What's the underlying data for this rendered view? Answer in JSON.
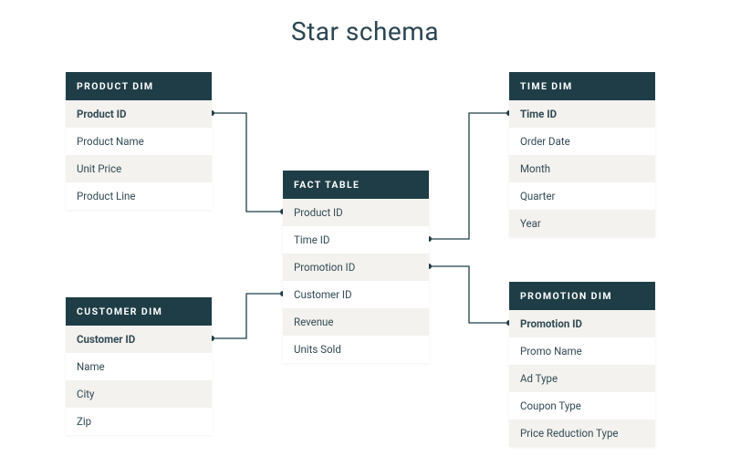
{
  "title": "Star schema",
  "colors": {
    "header_bg": "#1f3d47",
    "alt_row": "#f3f2ee",
    "line": "#1f3d47"
  },
  "tables": {
    "product": {
      "header": "PRODUCT DIM",
      "fields": [
        "Product ID",
        "Product Name",
        "Unit Price",
        "Product Line"
      ],
      "key_index": 0
    },
    "time": {
      "header": "TIME DIM",
      "fields": [
        "Time ID",
        "Order Date",
        "Month",
        "Quarter",
        "Year"
      ],
      "key_index": 0
    },
    "fact": {
      "header": "FACT TABLE",
      "fields": [
        "Product ID",
        "Time ID",
        "Promotion ID",
        "Customer ID",
        "Revenue",
        "Units Sold"
      ],
      "key_index": -1
    },
    "customer": {
      "header": "CUSTOMER DIM",
      "fields": [
        "Customer ID",
        "Name",
        "City",
        "Zip"
      ],
      "key_index": 0
    },
    "promotion": {
      "header": "PROMOTION DIM",
      "fields": [
        "Promotion ID",
        "Promo Name",
        "Ad Type",
        "Coupon Type",
        "Price Reduction Type"
      ],
      "key_index": 0
    }
  }
}
